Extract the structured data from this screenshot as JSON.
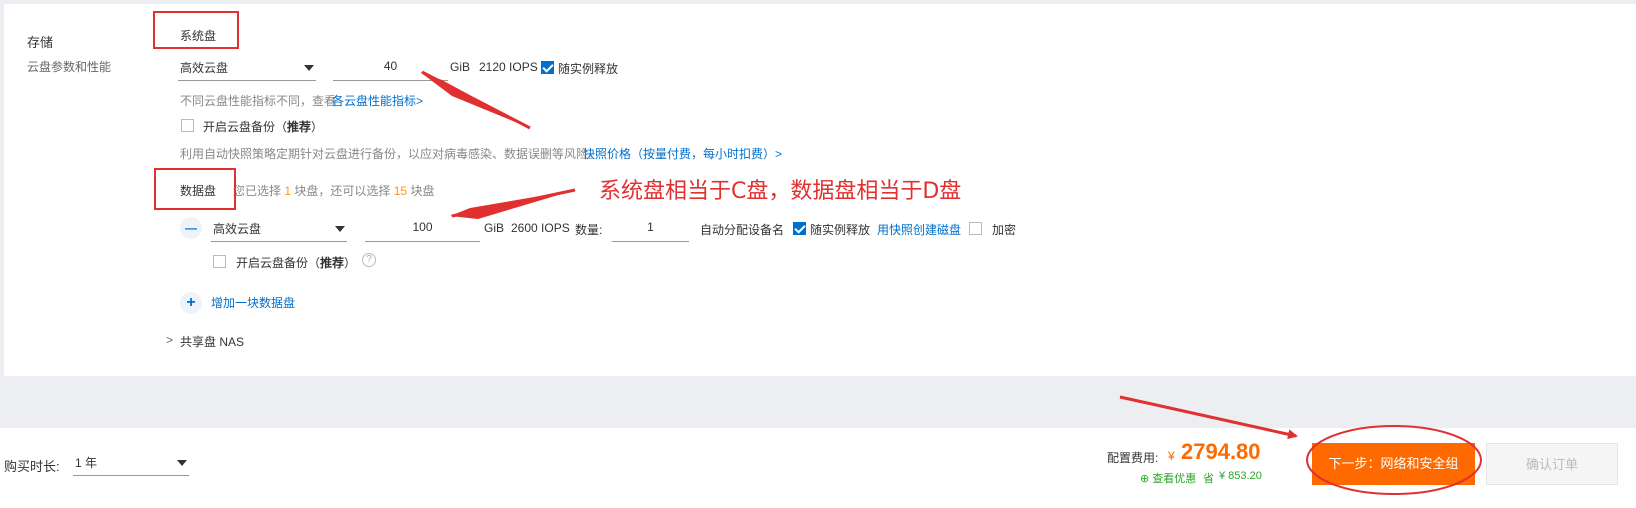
{
  "storage": {
    "title": "存储",
    "subtitle": "云盘参数和性能",
    "system_disk": {
      "label": "系统盘",
      "type": "高效云盘",
      "size": "40",
      "unit": "GiB",
      "iops": "2120 IOPS",
      "release_label": "随实例释放",
      "release_checked": true,
      "perf_note": "不同云盘性能指标不同，查看",
      "perf_link": "各云盘性能指标>",
      "backup_label": "开启云盘备份（",
      "backup_bold": "推荐",
      "backup_close": "）",
      "snapshot_note": "利用自动快照策略定期针对云盘进行备份，以应对病毒感染、数据误删等风险。",
      "snapshot_link": "快照价格（按量付费，每小时扣费）>"
    },
    "data_disk": {
      "label": "数据盘",
      "sel_prefix": "您已选择",
      "sel_count": "1",
      "sel_mid": "块盘，还可以选择",
      "sel_remain": "15",
      "sel_suffix": "块盘",
      "type": "高效云盘",
      "size": "100",
      "unit": "GiB",
      "iops": "2600 IOPS",
      "qty_label": "数量:",
      "qty": "1",
      "auto_name": "自动分配设备名",
      "release_label": "随实例释放",
      "release_checked": true,
      "snapshot_create_link": "用快照创建磁盘",
      "encrypt_label": "加密",
      "backup_label": "开启云盘备份（",
      "backup_bold": "推荐",
      "backup_close": "）",
      "add_label": "增加一块数据盘",
      "remove_symbol": "—",
      "add_symbol": "+",
      "help_symbol": "?"
    },
    "nas": {
      "chevron": ">",
      "label": "共享盘 NAS"
    }
  },
  "annotation": {
    "text": "系统盘相当于C盘，数据盘相当于D盘",
    "color": "#e0302f"
  },
  "footer": {
    "duration_label": "购买时长:",
    "duration_value": "1 年",
    "price_label": "配置费用:",
    "currency": "¥",
    "price": "2794.80",
    "discount_link": "查看优惠",
    "save_label": "省",
    "save_amount": "¥ 853.20",
    "next_button": "下一步：网络和安全组",
    "confirm_button": "确认订单"
  },
  "colors": {
    "accent": "#0070cc",
    "primary_button": "#ff6a00",
    "price": "#ff6a00",
    "discount": "#2aa52a"
  }
}
